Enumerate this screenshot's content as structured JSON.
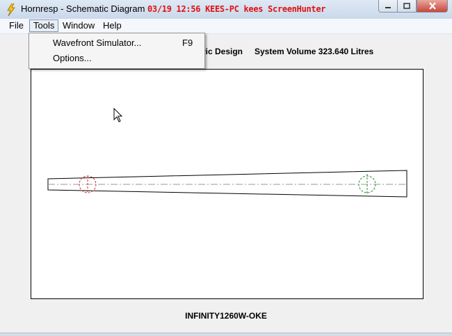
{
  "window": {
    "title": "Hornresp - Schematic Diagram",
    "overlay": "03/19 12:56 KEES-PC kees ScreenHunter"
  },
  "menubar": {
    "items": [
      {
        "label": "File"
      },
      {
        "label": "Tools"
      },
      {
        "label": "Window"
      },
      {
        "label": "Help"
      }
    ],
    "active": "Tools"
  },
  "dropdown": {
    "items": [
      {
        "label": "Wavefront Simulator...",
        "shortcut": "F9"
      },
      {
        "label": "Options...",
        "shortcut": ""
      }
    ]
  },
  "info": {
    "design_fragment": "tric Design",
    "system_volume": "System Volume 323.640 Litres"
  },
  "diagram": {
    "driver_color": "#d03030",
    "port_color": "#2a8a2a",
    "axis_color": "#999999"
  },
  "footer": {
    "name": "INFINITY1260W-OKE"
  }
}
